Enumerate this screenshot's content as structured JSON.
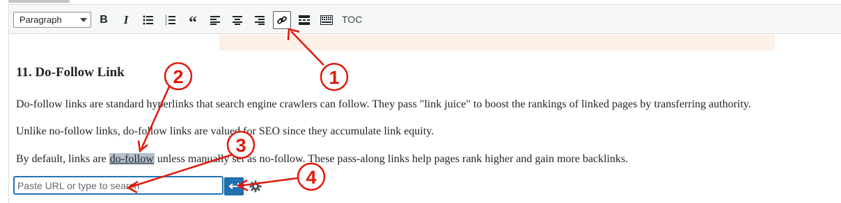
{
  "toolbar": {
    "format_value": "Paragraph",
    "buttons": [
      {
        "name": "bold",
        "icon": "bold-icon"
      },
      {
        "name": "italic",
        "icon": "italic-icon"
      },
      {
        "name": "bulleted-list",
        "icon": "bulleted-list-icon"
      },
      {
        "name": "numbered-list",
        "icon": "numbered-list-icon"
      },
      {
        "name": "blockquote",
        "icon": "quote-icon"
      },
      {
        "name": "align-left",
        "icon": "align-left-icon"
      },
      {
        "name": "align-center",
        "icon": "align-center-icon"
      },
      {
        "name": "align-right",
        "icon": "align-right-icon"
      },
      {
        "name": "insert-link",
        "icon": "link-icon",
        "active": true
      },
      {
        "name": "read-more",
        "icon": "read-more-icon"
      },
      {
        "name": "toolbar-toggle",
        "icon": "keyboard-icon"
      }
    ],
    "toc_label": "TOC"
  },
  "content": {
    "heading": "11. Do-Follow Link",
    "para1": "Do-follow links are standard hyperlinks that search engine crawlers can follow. They pass \"link juice\" to boost the rankings of linked pages by transferring authority.",
    "para2": "Unlike no-follow links, do-follow links are valued for SEO since they accumulate link equity.",
    "para3_before": "By default, links are ",
    "para3_selected": "do-follow",
    "para3_after": " unless manually set as no-follow. These pass-along links help pages rank higher and gain more backlinks."
  },
  "link_popup": {
    "placeholder": "Paste URL or type to search",
    "apply_icon": "enter-arrow-icon",
    "settings_icon": "gear-icon"
  },
  "annotations": {
    "color": "#e3170a",
    "labels": [
      "1",
      "2",
      "3",
      "4"
    ]
  }
}
